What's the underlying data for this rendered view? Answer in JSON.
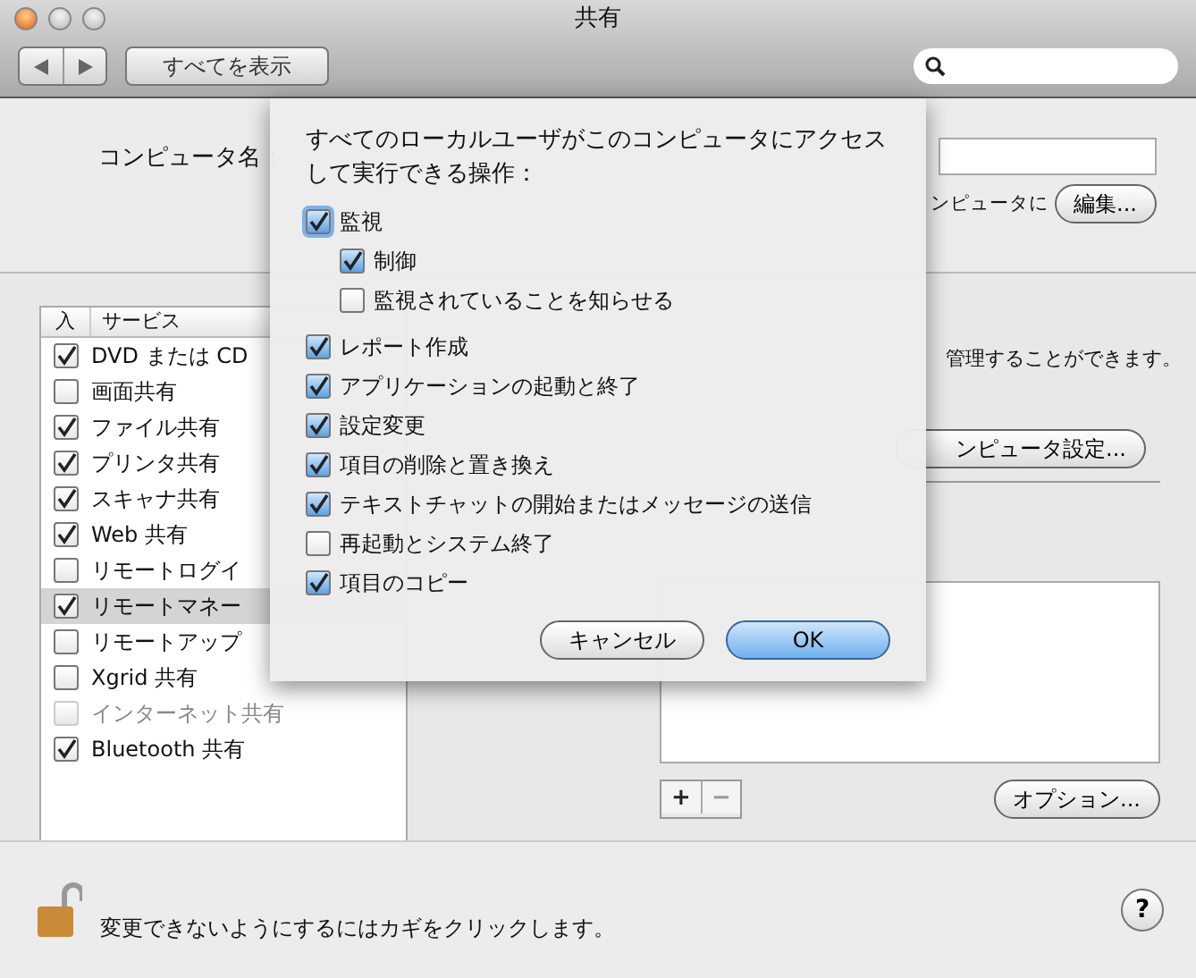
{
  "window": {
    "title": "共有"
  },
  "toolbar": {
    "show_all": "すべてを表示"
  },
  "computer_name": {
    "label": "コンピュータ名：",
    "hint": "ンピュータに",
    "edit_button": "編集..."
  },
  "services": {
    "columns": [
      "入",
      "サービス"
    ],
    "rows": [
      {
        "name": "DVD または CD",
        "checked": true,
        "selected": false,
        "disabled": false
      },
      {
        "name": "画面共有",
        "checked": false,
        "selected": false,
        "disabled": false
      },
      {
        "name": "ファイル共有",
        "checked": true,
        "selected": false,
        "disabled": false
      },
      {
        "name": "プリンタ共有",
        "checked": true,
        "selected": false,
        "disabled": false
      },
      {
        "name": "スキャナ共有",
        "checked": true,
        "selected": false,
        "disabled": false
      },
      {
        "name": "Web 共有",
        "checked": true,
        "selected": false,
        "disabled": false
      },
      {
        "name": "リモートログイ",
        "checked": false,
        "selected": false,
        "disabled": false
      },
      {
        "name": "リモートマネー",
        "checked": true,
        "selected": true,
        "disabled": false
      },
      {
        "name": "リモートアップ",
        "checked": false,
        "selected": false,
        "disabled": false
      },
      {
        "name": "Xgrid 共有",
        "checked": false,
        "selected": false,
        "disabled": false
      },
      {
        "name": "インターネット共有",
        "checked": false,
        "selected": false,
        "disabled": true
      },
      {
        "name": "Bluetooth 共有",
        "checked": true,
        "selected": false,
        "disabled": false
      }
    ]
  },
  "detail": {
    "description": "管理することができます。",
    "settings_button": "ンピュータ設定...",
    "list_buttons": [
      "+",
      "−"
    ],
    "options_button": "オプション..."
  },
  "sheet": {
    "title": "すべてのローカルユーザがこのコンピュータにアクセスして実行できる操作：",
    "items": [
      {
        "label": "監視",
        "checked": true,
        "focused": true,
        "children": [
          {
            "label": "制御",
            "checked": true
          },
          {
            "label": "監視されていることを知らせる",
            "checked": false
          }
        ]
      },
      {
        "label": "レポート作成",
        "checked": true
      },
      {
        "label": "アプリケーションの起動と終了",
        "checked": true
      },
      {
        "label": "設定変更",
        "checked": true
      },
      {
        "label": "項目の削除と置き換え",
        "checked": true
      },
      {
        "label": "テキストチャットの開始またはメッセージの送信",
        "checked": true
      },
      {
        "label": "再起動とシステム終了",
        "checked": false
      },
      {
        "label": "項目のコピー",
        "checked": true
      }
    ],
    "buttons": [
      {
        "label": "キャンセル",
        "default": false
      },
      {
        "label": "OK",
        "default": true
      }
    ]
  },
  "footer": {
    "lock_text": "変更できないようにするにはカギをクリックします。",
    "help": "?"
  }
}
